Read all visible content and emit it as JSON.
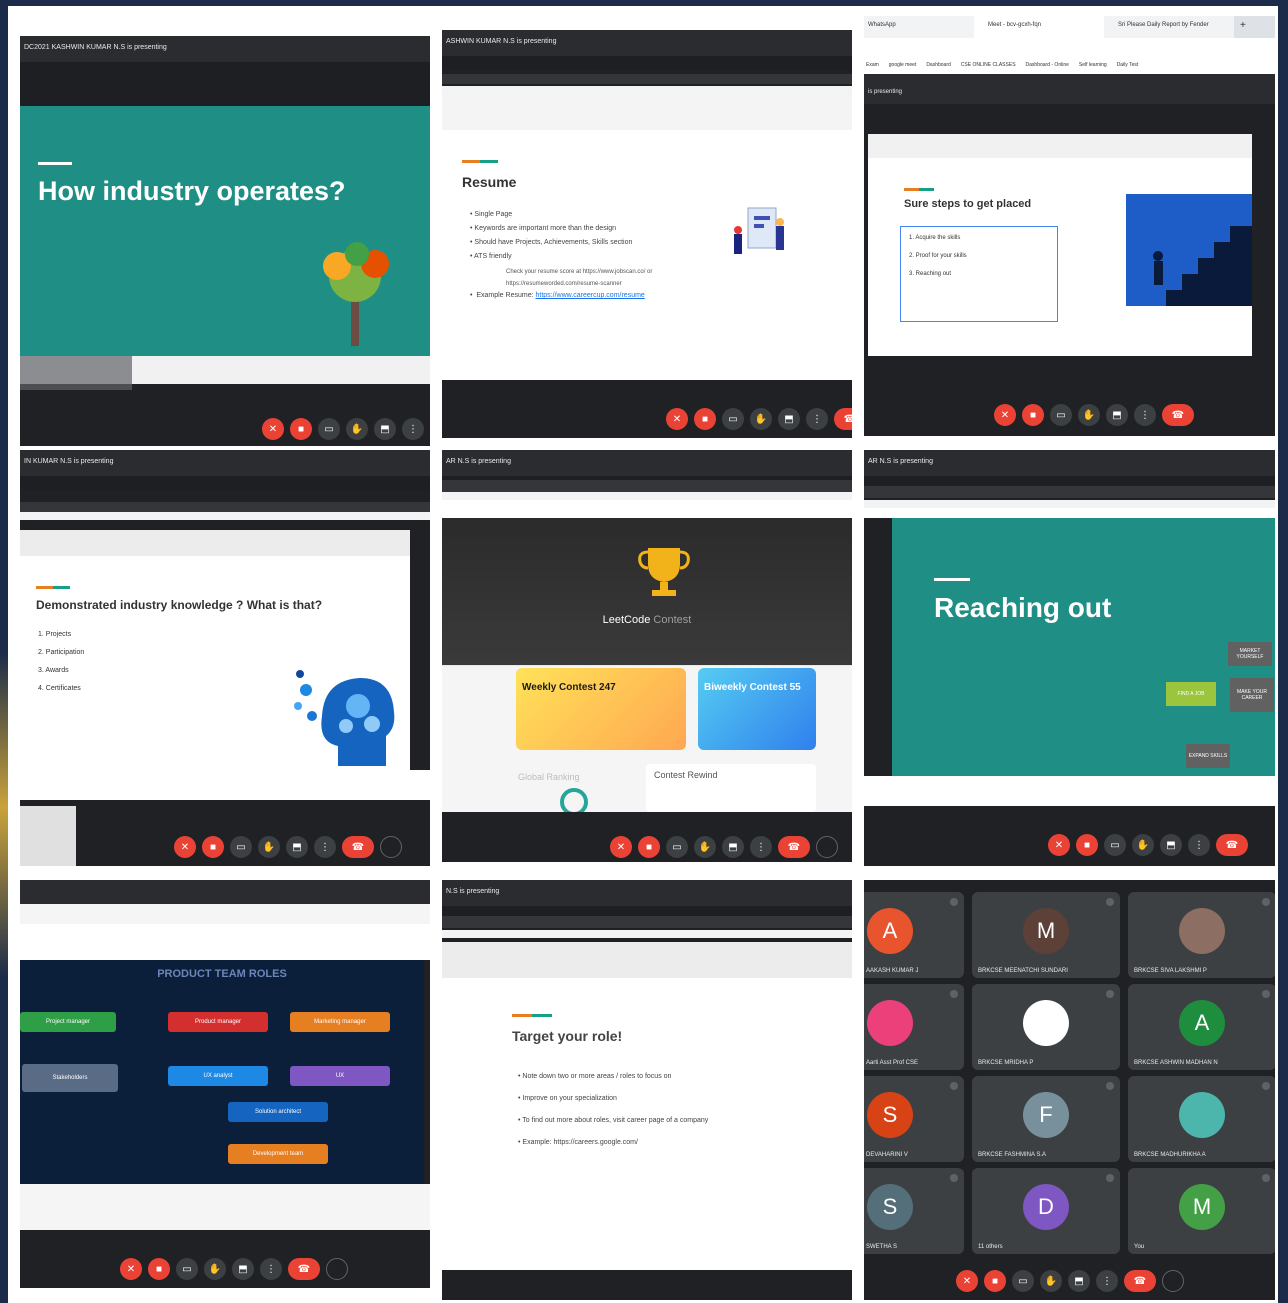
{
  "tiles": {
    "t1": {
      "presenter": "DC2021 KASHWIN KUMAR N.S is presenting",
      "title": "How industry operates?"
    },
    "t2": {
      "presenter": "ASHWIN KUMAR N.S is presenting",
      "title": "Resume",
      "bullets": [
        "Single Page",
        "Keywords are important more than the design",
        "Should have Projects, Achievements, Skills section",
        "ATS friendly"
      ],
      "sub": "Check your resume score at https://www.jobscan.co/ or https://resumeworded.com/resume-scanner",
      "example_label": "Example Resume:",
      "example_link": "https://www.careercup.com/resume"
    },
    "t3": {
      "tabs": [
        "WhatsApp",
        "Meet - bcv-gcxh-fqn",
        "Sri Please Daily Report by Fender"
      ],
      "bookmarks": [
        "Exam",
        "google meet",
        "Dashboard",
        "CSE ONLINE CLASSES",
        "Dashboard - Online",
        "Self learning",
        "Daily Test"
      ],
      "presenter": "is presenting",
      "title": "Sure steps to get placed",
      "steps": [
        "1.   Acquire the skills",
        "2.   Proof for your skills",
        "3.   Reaching out"
      ]
    },
    "t4": {
      "presenter": "IN KUMAR N.S is presenting",
      "title": "Demonstrated industry knowledge ? What is that?",
      "items": [
        "1.   Projects",
        "2.   Participation",
        "3.   Awards",
        "4.   Certificates"
      ]
    },
    "t5": {
      "presenter": "AR N.S is presenting",
      "brand": "LeetCode",
      "brand_suffix": "Contest",
      "weekly": "Weekly Contest 247",
      "biweekly": "Biweekly Contest 55",
      "global": "Global Ranking",
      "rewind": "Contest Rewind"
    },
    "t6": {
      "presenter": "AR N.S is presenting",
      "title": "Reaching out",
      "cycle": [
        "FIND A JOB",
        "MARKET YOURSELF",
        "MAKE YOUR CAREER",
        "EXPAND SKILLS"
      ]
    },
    "t7": {
      "title": "PRODUCT TEAM ROLES",
      "roles": [
        "Project manager",
        "Product manager",
        "Marketing manager",
        "Stakeholders",
        "UX analyst",
        "UX",
        "Solution architect",
        "Development team"
      ]
    },
    "t8": {
      "presenter": "N.S is presenting",
      "title": "Target your role!",
      "bullets": [
        "Note down two or more areas / roles to focus on",
        "Improve on your specialization",
        "To find out more about roles, visit career page of a company",
        "Example: https://careers.google.com/"
      ]
    },
    "t9": {
      "participants": [
        {
          "initial": "A",
          "name": "AAKASH KUMAR J",
          "color": "#e8542d"
        },
        {
          "initial": "M",
          "name": "BRKCSE MEENATCHI SUNDARI",
          "color": "#5d4037"
        },
        {
          "initial": "",
          "name": "BRKCSE SIVA LAKSHMI P",
          "color": "#8d6e63"
        },
        {
          "initial": "",
          "name": "Aarti Asst Prof CSE",
          "color": "#ec407a"
        },
        {
          "initial": "",
          "name": "BRKCSE MRIDHA P",
          "color": "#ffffff"
        },
        {
          "initial": "A",
          "name": "BRKCSE ASHWIN MADHAN N",
          "color": "#1e8e3e"
        },
        {
          "initial": "S",
          "name": "DEVAHARINI V",
          "color": "#d84315"
        },
        {
          "initial": "F",
          "name": "BRKCSE FASHMINA S.A",
          "color": "#78909c"
        },
        {
          "initial": "",
          "name": "BRKCSE MADHURIKHA A",
          "color": "#4db6ac"
        },
        {
          "initial": "S",
          "name": "SWETHA S",
          "color": "#546e7a"
        },
        {
          "initial": "D",
          "name": "11 others",
          "color": "#7e57c2"
        },
        {
          "initial": "M",
          "name": "You",
          "color": "#43a047"
        }
      ]
    }
  },
  "colors": {
    "teal": "#1f8f86",
    "navy": "#0b1e3a",
    "meetRed": "#ea4335",
    "dark": "#202124"
  }
}
